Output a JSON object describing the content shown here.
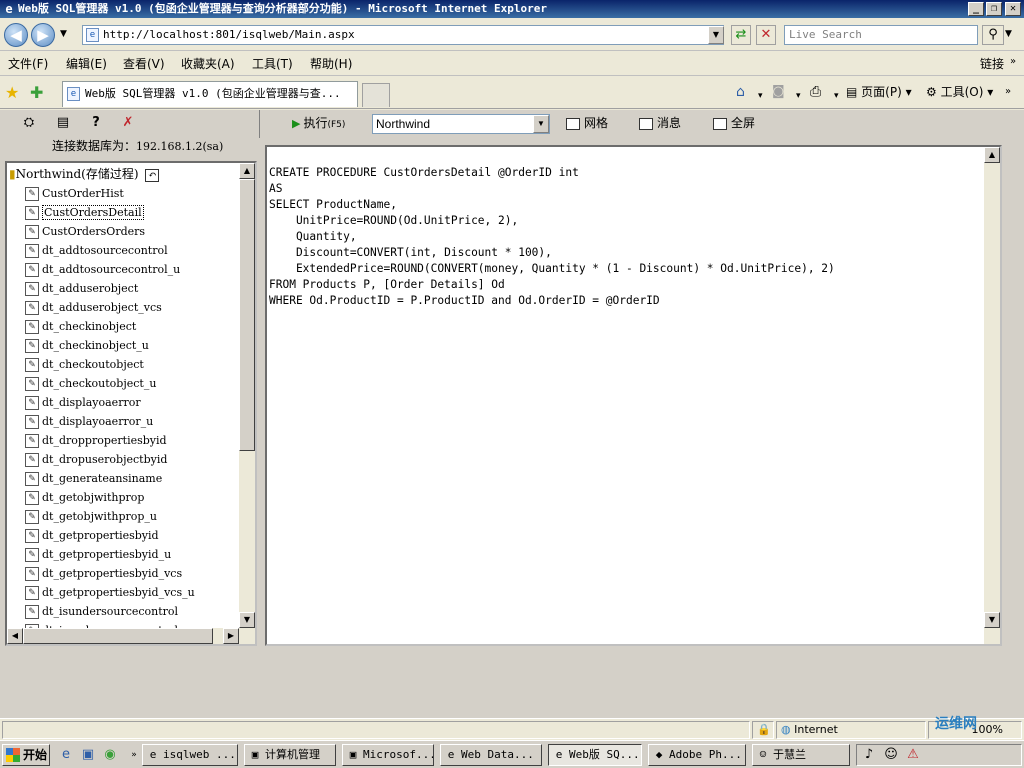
{
  "window": {
    "title": "Web版 SQL管理器 v1.0 (包函企业管理器与查询分析器部分功能) - Microsoft Internet Explorer"
  },
  "addressbar": {
    "url": "http://localhost:801/isqlweb/Main.aspx",
    "search_placeholder": "Live Search"
  },
  "menubar": {
    "items": [
      "文件(F)",
      "编辑(E)",
      "查看(V)",
      "收藏夹(A)",
      "工具(T)",
      "帮助(H)"
    ],
    "links_label": "链接"
  },
  "tabs": {
    "active_label": "Web版 SQL管理器 v1.0 (包函企业管理器与查..."
  },
  "commandbar": {
    "page_label": "页面(P)",
    "tools_label": "工具(O)"
  },
  "lefttoolbar": {
    "connection_prefix": "连接数据库为：",
    "connection_ip": "192.168.1.2(sa)"
  },
  "tree": {
    "root_label": "Northwind(存储过程)",
    "items": [
      "CustOrderHist",
      "CustOrdersDetail",
      "CustOrdersOrders",
      "dt_addtosourcecontrol",
      "dt_addtosourcecontrol_u",
      "dt_adduserobject",
      "dt_adduserobject_vcs",
      "dt_checkinobject",
      "dt_checkinobject_u",
      "dt_checkoutobject",
      "dt_checkoutobject_u",
      "dt_displayoaerror",
      "dt_displayoaerror_u",
      "dt_droppropertiesbyid",
      "dt_dropuserobjectbyid",
      "dt_generateansiname",
      "dt_getobjwithprop",
      "dt_getobjwithprop_u",
      "dt_getpropertiesbyid",
      "dt_getpropertiesbyid_u",
      "dt_getpropertiesbyid_vcs",
      "dt_getpropertiesbyid_vcs_u",
      "dt_isundersourcecontrol",
      "dt_isundersourcecontrol_u"
    ],
    "selected_index": 1
  },
  "righttoolbar": {
    "execute_label": "执行",
    "execute_key": "(F5)",
    "database": "Northwind",
    "grid_label": "网格",
    "messages_label": "消息",
    "fullscreen_label": "全屏"
  },
  "editor": {
    "sql": "CREATE PROCEDURE CustOrdersDetail @OrderID int\nAS\nSELECT ProductName,\n    UnitPrice=ROUND(Od.UnitPrice, 2),\n    Quantity,\n    Discount=CONVERT(int, Discount * 100),\n    ExtendedPrice=ROUND(CONVERT(money, Quantity * (1 - Discount) * Od.UnitPrice), 2)\nFROM Products P, [Order Details] Od\nWHERE Od.ProductID = P.ProductID and Od.OrderID = @OrderID"
  },
  "statusbar": {
    "zone": "Internet",
    "zoom": "100%"
  },
  "taskbar": {
    "start_label": "开始",
    "buttons": [
      "isqlweb ...",
      "计算机管理",
      "Microsof...",
      "Web Data...",
      "Web版 SQ...",
      "Adobe Ph...",
      "于慧兰"
    ],
    "active_index": 4
  },
  "watermark": "运维网"
}
